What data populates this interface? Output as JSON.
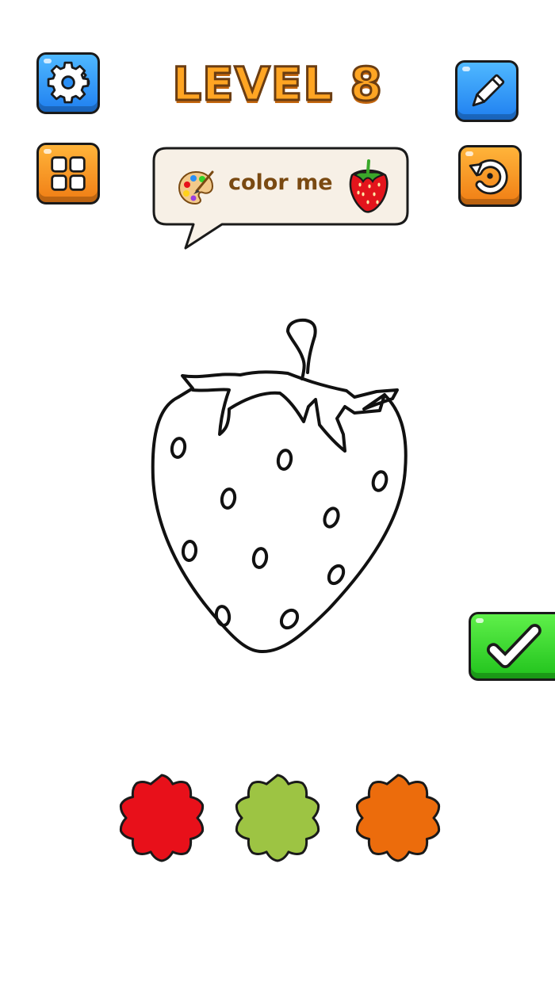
{
  "header": {
    "level_title": "LEVEL 8"
  },
  "toolbar": {
    "settings_icon": "gear-icon",
    "pencil_icon": "pencil-icon",
    "menu_icon": "grid-icon",
    "reset_icon": "undo-icon",
    "confirm_icon": "checkmark-icon"
  },
  "hint": {
    "text": "color me",
    "left_icon": "palette-icon",
    "right_icon": "strawberry-icon"
  },
  "canvas": {
    "subject": "strawberry-outline"
  },
  "palette": {
    "colors": [
      {
        "name": "red",
        "hex": "#e8101a"
      },
      {
        "name": "green",
        "hex": "#9dc443"
      },
      {
        "name": "orange",
        "hex": "#ec6c0c"
      }
    ]
  },
  "colors": {
    "blue_button": "#2a8ff5",
    "orange_button": "#f59520",
    "green_button": "#32d42a",
    "title_fill": "#ffa523",
    "bubble_bg": "#f7f0e6"
  }
}
